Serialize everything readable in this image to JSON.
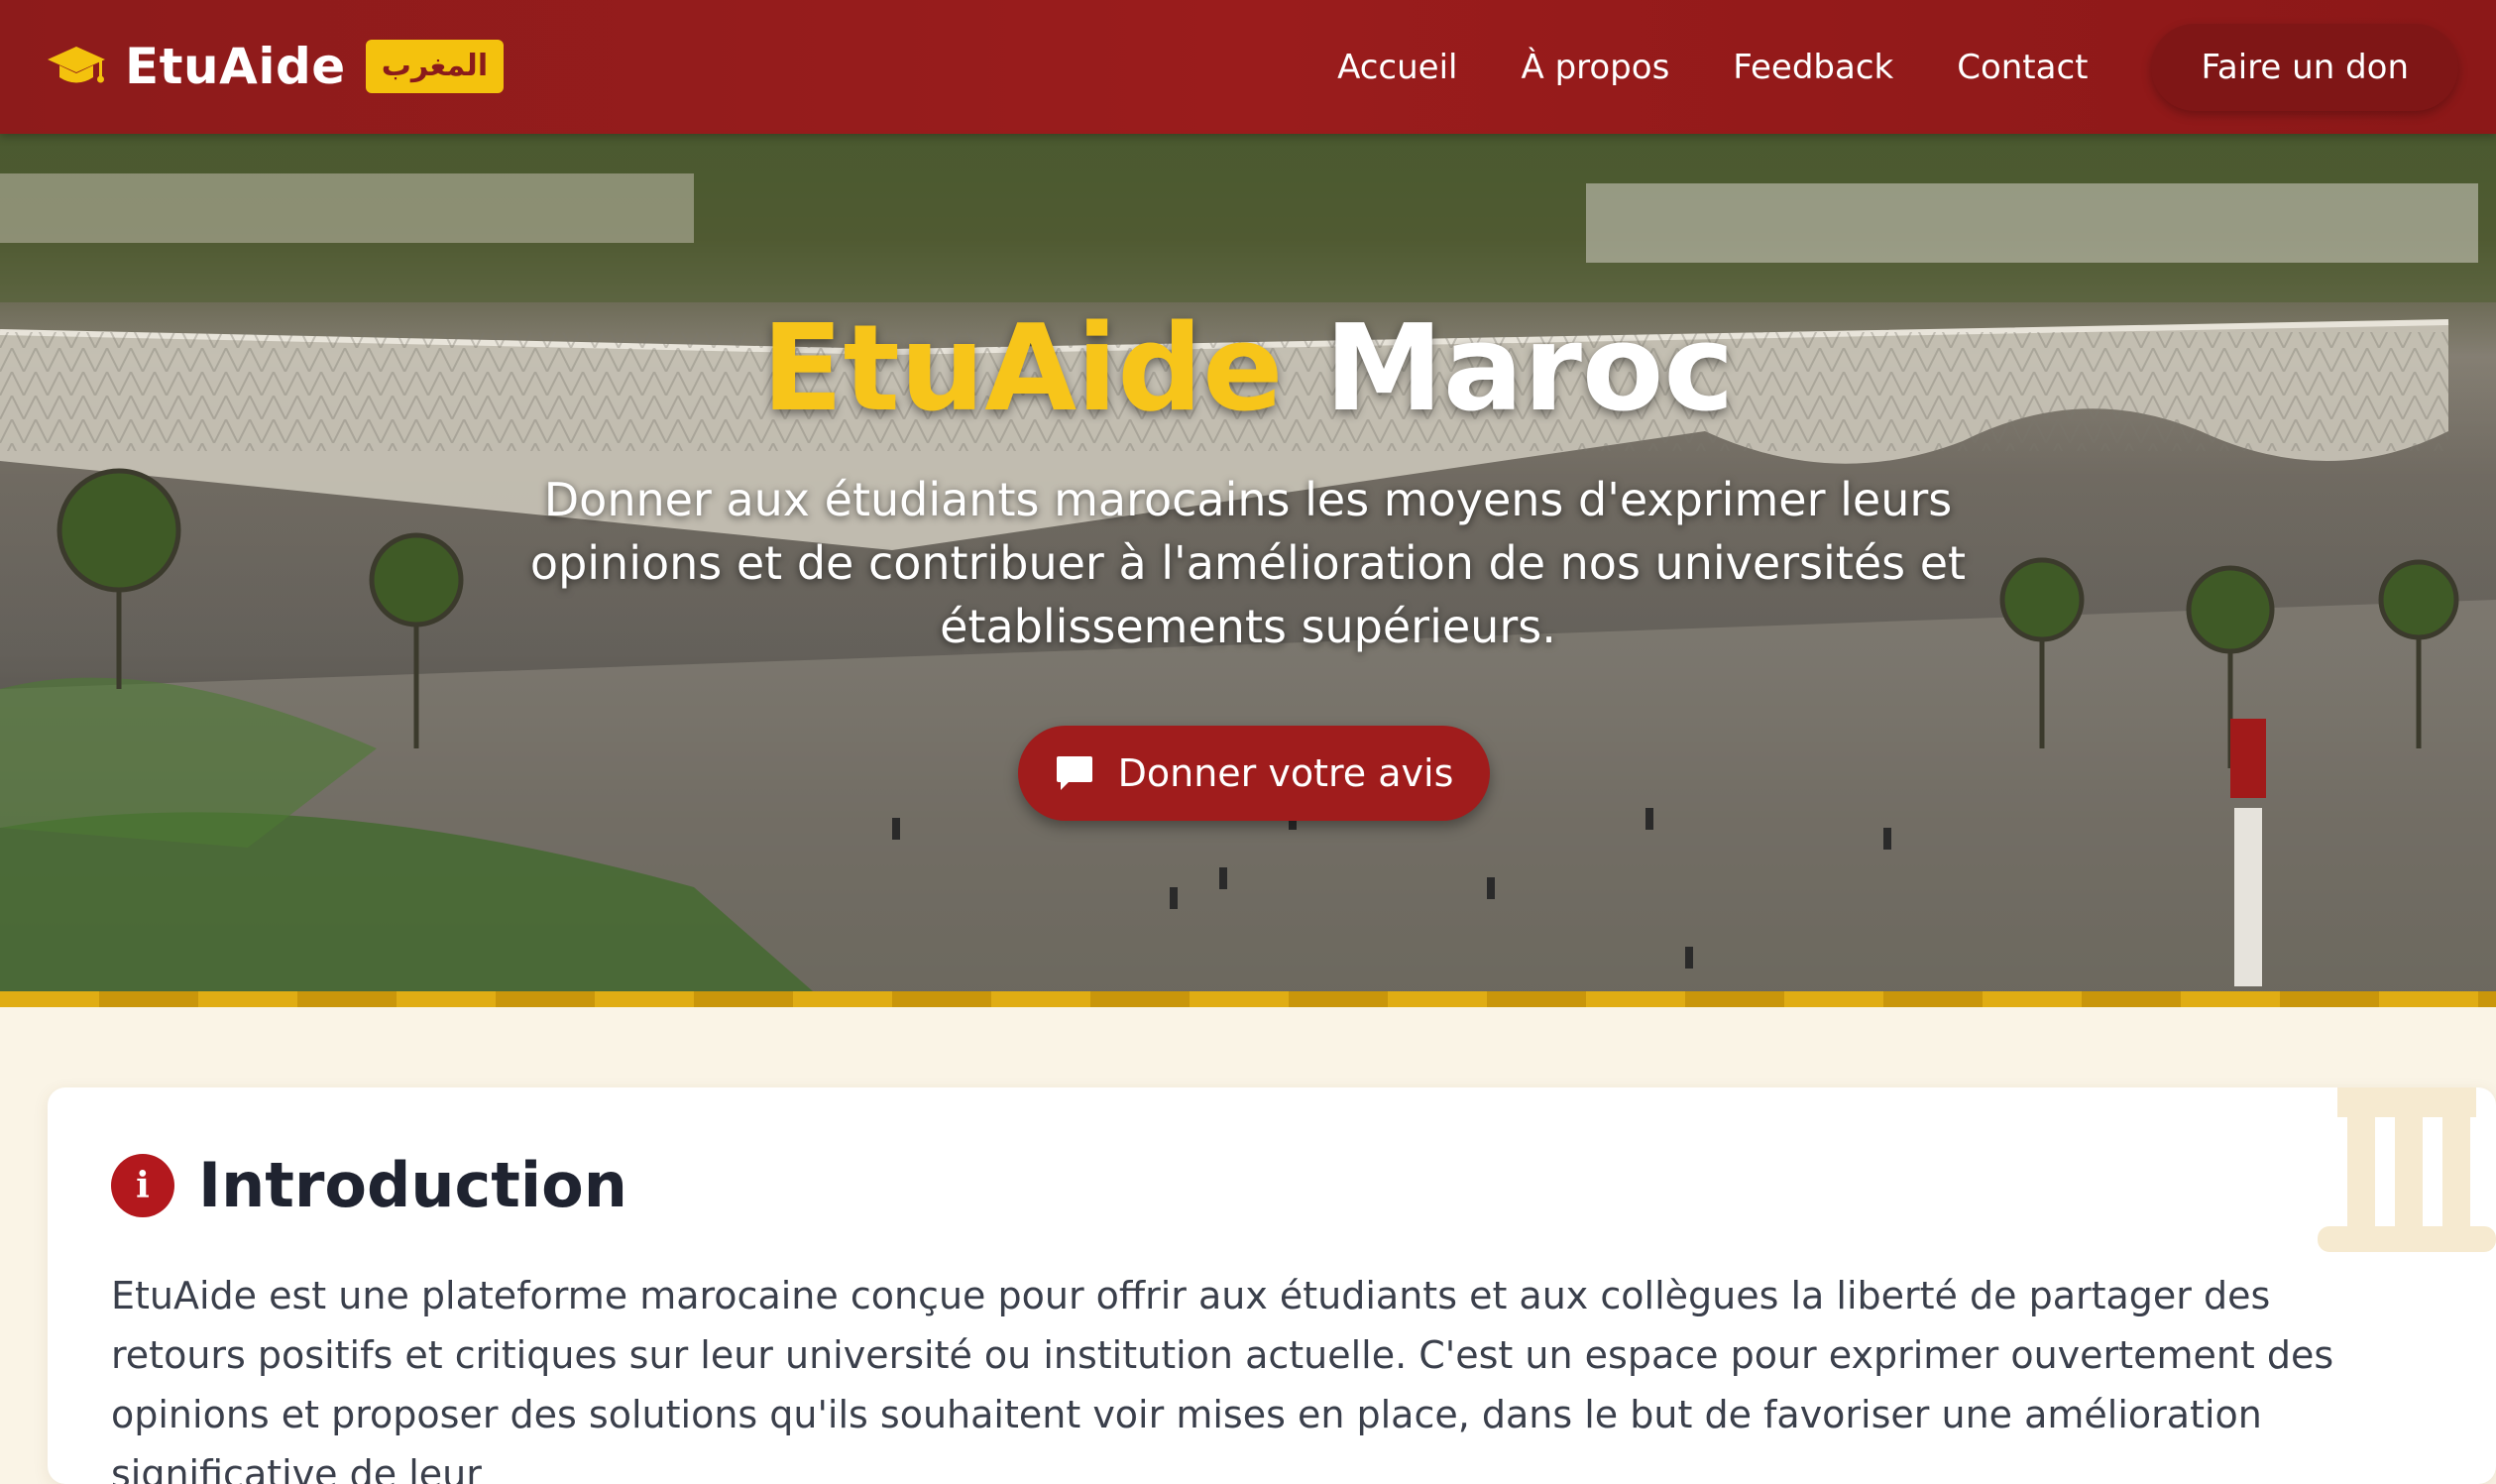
{
  "header": {
    "brand_name": "EtuAide",
    "brand_badge": "المغرب",
    "nav": [
      "Accueil",
      "À propos",
      "Feedback",
      "Contact"
    ],
    "cta": "Faire un don"
  },
  "hero": {
    "title_part1": "EtuAide",
    "title_part2": "Maroc",
    "subtitle": "Donner aux étudiants marocains les moyens d'exprimer leurs opinions et de contribuer à l'amélioration de nos universités et établissements supérieurs.",
    "button_label": "Donner votre avis"
  },
  "intro": {
    "title": "Introduction",
    "text": "EtuAide est une plateforme marocaine conçue pour offrir aux étudiants et aux collègues la liberté de partager des retours positifs et critiques sur leur université ou institution actuelle. C'est un espace pour exprimer ouvertement des opinions et proposer des solutions qu'ils souhaitent voir mises en place, dans le but de favoriser une amélioration significative de leur"
  },
  "colors": {
    "brand_red": "#8d1b1b",
    "accent_gold": "#f4c20d",
    "page_background": "#faf4e6"
  },
  "icons": [
    "graduation-cap-icon",
    "chat-bubble-icon",
    "info-icon",
    "building-columns-icon"
  ]
}
